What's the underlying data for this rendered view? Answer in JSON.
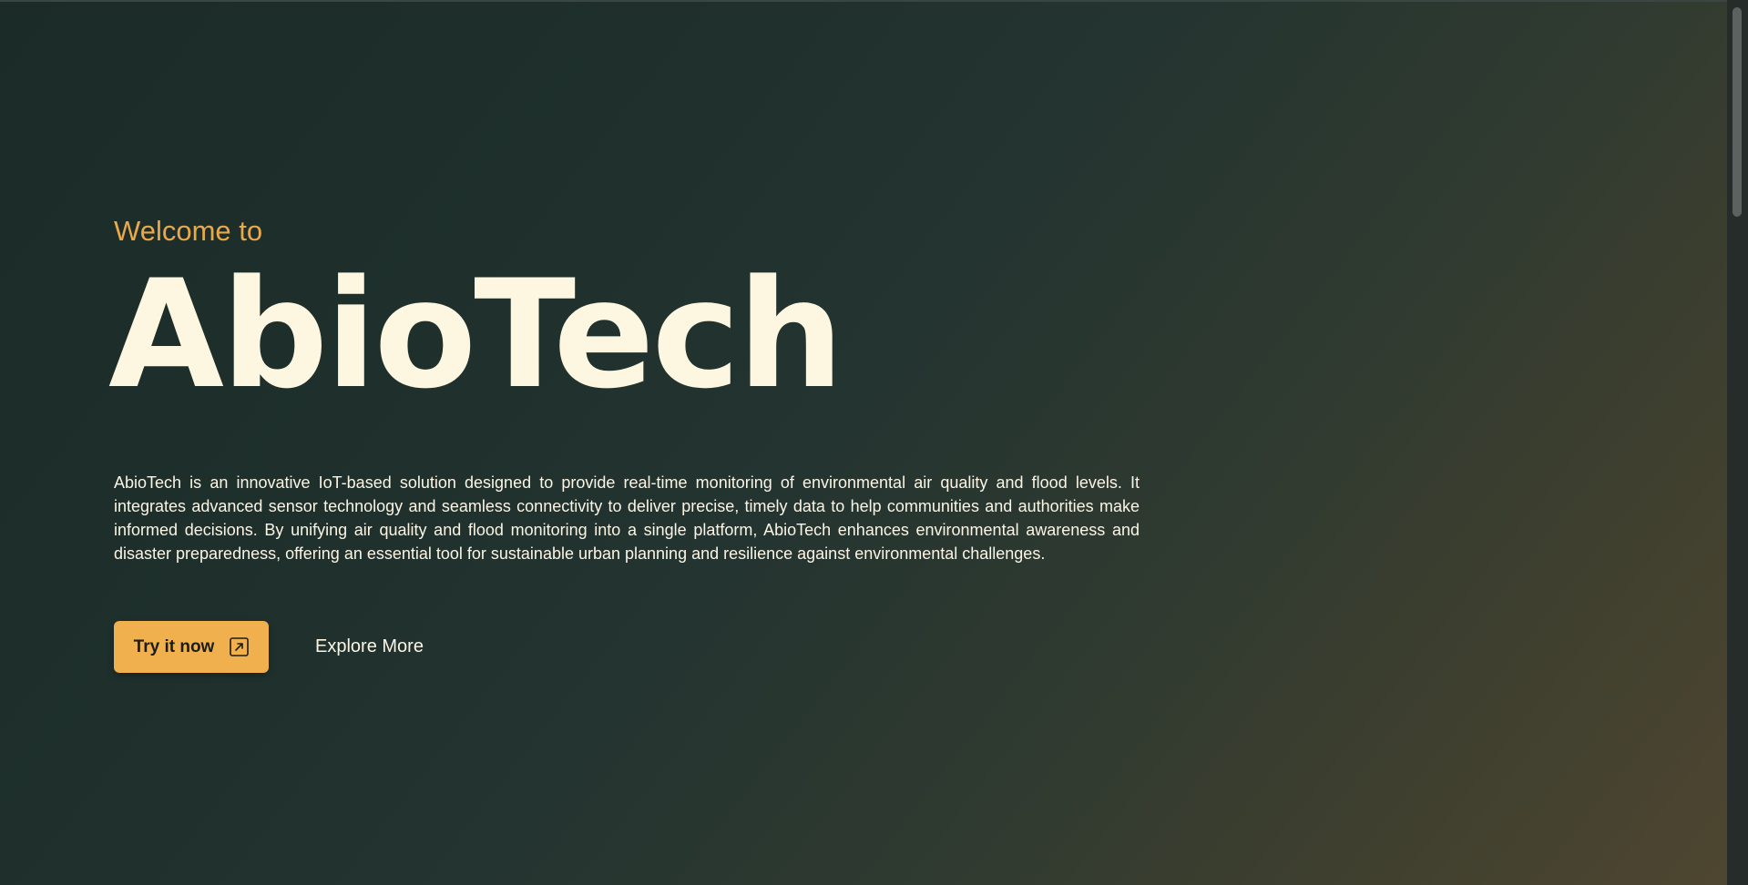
{
  "hero": {
    "eyebrow": "Welcome to",
    "title": "AbioTech",
    "description": "AbioTech is an innovative IoT-based solution designed to provide real-time monitoring of environmental air quality and flood levels. It integrates advanced sensor technology and seamless connectivity to deliver precise, timely data to help communities and authorities make informed decisions. By unifying air quality and flood monitoring into a single platform, AbioTech enhances environmental awareness and disaster preparedness, offering an essential tool for sustainable urban planning and resilience against environmental challenges.",
    "primary_cta": {
      "label": "Try it now",
      "icon": "external-link-icon"
    },
    "secondary_cta": {
      "label": "Explore More"
    }
  },
  "colors": {
    "accent": "#f1b04e",
    "eyebrow": "#e9a94a",
    "title": "#fdf7e1",
    "text": "#fbf5e6",
    "background_start": "#1b2b28",
    "background_end": "#4f4630"
  }
}
